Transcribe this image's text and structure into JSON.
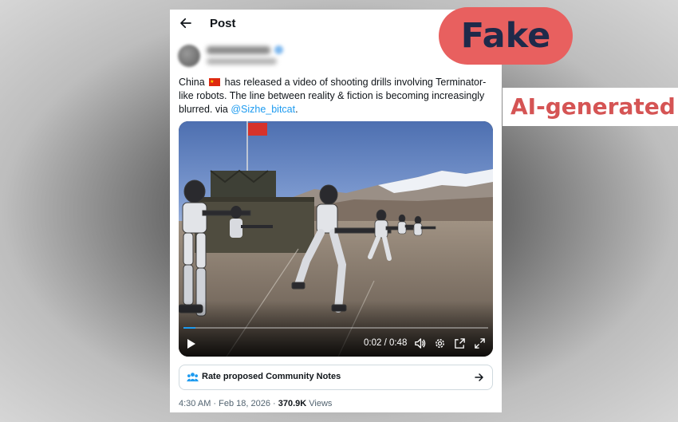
{
  "topbar": {
    "title": "Post"
  },
  "tweet": {
    "text_before_flag": "China ",
    "text_after_flag": " has released a video of shooting drills involving Terminator-like robots. The line between reality & fiction is becoming increasingly blurred. via ",
    "mention": "@Sizhe_bitcat",
    "text_end": "."
  },
  "video": {
    "time": "0:02 / 0:48",
    "progress": 0.04
  },
  "community_notes": {
    "label": "Rate proposed Community Notes"
  },
  "meta": {
    "time_date": "4:30 AM · Feb 18, 2026 · ",
    "views_count": "370.9K",
    "views_label": " Views"
  },
  "overlay": {
    "fake_label": "Fake",
    "ai_label": "AI-generated"
  },
  "colors": {
    "fake_badge": "#e8605f",
    "ai_text": "#d55454",
    "link": "#1d9bf0"
  }
}
